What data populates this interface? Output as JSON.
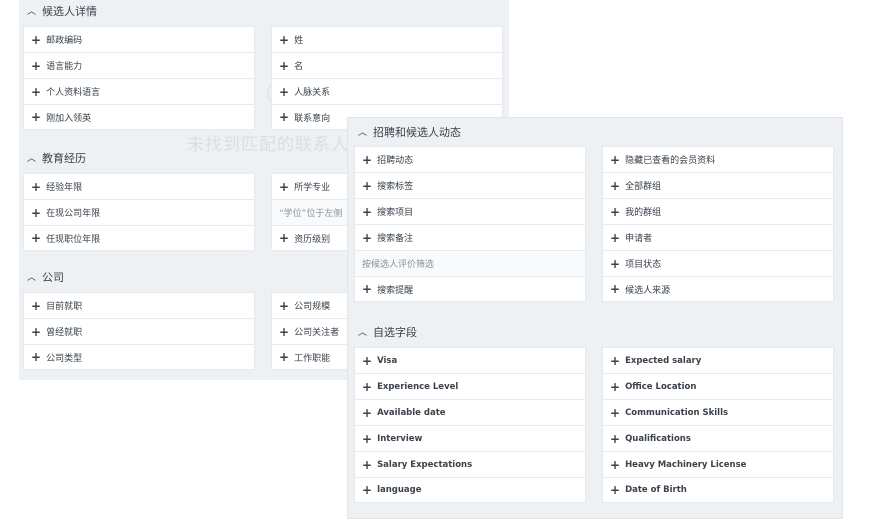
{
  "back": {
    "candidate_details": {
      "title": "候选人详情",
      "left": [
        "邮政编码",
        "语言能力",
        "个人资料语言",
        "刚加入领英"
      ],
      "right": [
        "姓",
        "名",
        "人脉关系",
        "联系意向"
      ]
    },
    "education": {
      "title": "教育经历",
      "left": [
        "经验年限",
        "在现公司年限",
        "任现职位年限"
      ],
      "right": [
        "所学专业",
        "“学位”位于左侧",
        "资历级别"
      ]
    },
    "company": {
      "title": "公司",
      "left": [
        "目前就职",
        "曾经就职",
        "公司类型"
      ],
      "right": [
        "公司规模",
        "公司关注者",
        "工作职能"
      ]
    },
    "watermark": "未找到匹配的联系人"
  },
  "front": {
    "recruiting": {
      "title": "招聘和候选人动态",
      "left": [
        "招聘动态",
        "搜索标签",
        "搜索项目",
        "搜索备注",
        "按候选人评价筛选",
        "搜索提醒"
      ],
      "right": [
        "隐藏已查看的会员资料",
        "全部群组",
        "我的群组",
        "申请者",
        "项目状态",
        "候选人来源"
      ]
    },
    "custom_fields": {
      "title": "自选字段",
      "left": [
        "Visa",
        "Experience Level",
        "Available date",
        "Interview",
        "Salary Expectations",
        "language"
      ],
      "right": [
        "Expected salary",
        "Office Location",
        "Communication Skills",
        "Qualifications",
        "Heavy Machinery License",
        "Date of Birth"
      ]
    }
  },
  "icons": {
    "expand": "chevron-up-icon",
    "add": "plus-icon"
  },
  "no_plus_items": [
    "“学位”位于左侧",
    "按候选人评价筛选"
  ]
}
